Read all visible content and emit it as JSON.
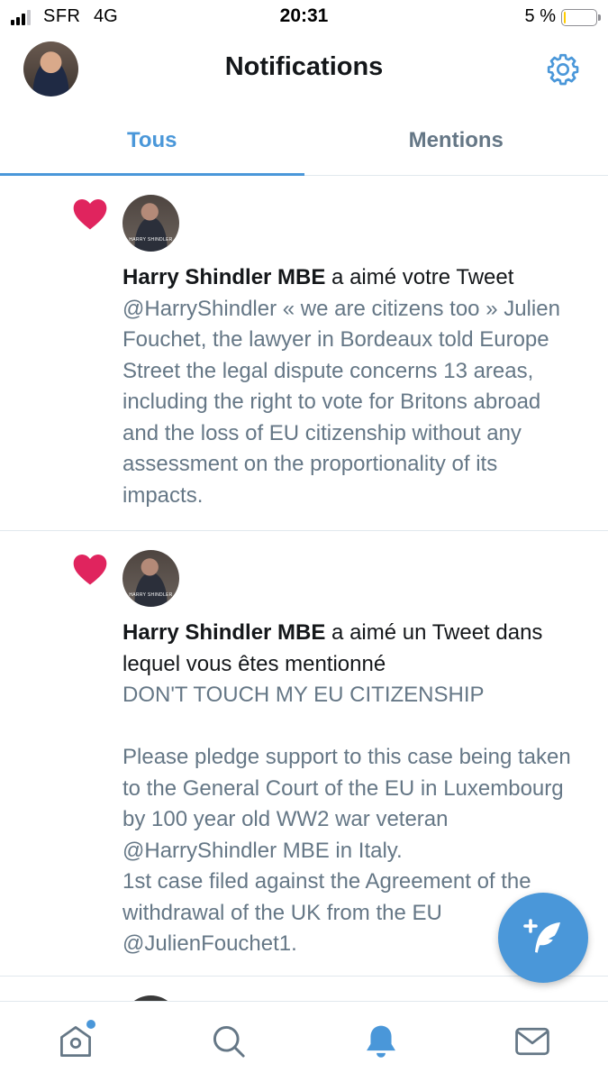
{
  "status_bar": {
    "carrier": "SFR",
    "network": "4G",
    "time": "20:31",
    "battery_text": "5 %",
    "battery_level": 0.05
  },
  "header": {
    "title": "Notifications",
    "avatar_icon": "user-avatar",
    "settings_icon": "gear-icon"
  },
  "tabs": [
    {
      "label": "Tous",
      "active": true
    },
    {
      "label": "Mentions",
      "active": false
    }
  ],
  "notifications": [
    {
      "icon": "heart-icon",
      "actor": "Harry Shindler MBE",
      "action": " a aimé votre Tweet",
      "avatar_caption": "HARRY SHINDLER",
      "tweet": "@HarryShindler « we are citizens too » Julien Fouchet, the lawyer in Bordeaux told Europe Street the legal dispute concerns 13 areas, including the right to vote for Britons abroad and the loss of EU citizenship without any assessment on the proportionality of its impacts."
    },
    {
      "icon": "heart-icon",
      "actor": "Harry Shindler MBE",
      "action": " a aimé un Tweet dans lequel vous êtes mentionné",
      "avatar_caption": "HARRY SHINDLER",
      "tweet": "DON'T TOUCH MY EU CITIZENSHIP\n\nPlease pledge support to this case being taken to the General Court of the EU in Luxembourg by 100 year old WW2 war veteran @HarryShindler MBE in Italy.\n1st case filed against the Agreement of the withdrawal of the UK from the EU @JulienFouchet1."
    }
  ],
  "colors": {
    "accent": "#4a97d9",
    "heart": "#e0245e",
    "secondary_text": "#657786"
  },
  "bottom_nav": [
    {
      "name": "home",
      "icon": "home-icon",
      "has_dot": true
    },
    {
      "name": "search",
      "icon": "search-icon",
      "has_dot": false
    },
    {
      "name": "notifications",
      "icon": "bell-icon",
      "active": true
    },
    {
      "name": "messages",
      "icon": "envelope-icon",
      "has_dot": false
    }
  ],
  "fab_icon": "compose-tweet-icon"
}
